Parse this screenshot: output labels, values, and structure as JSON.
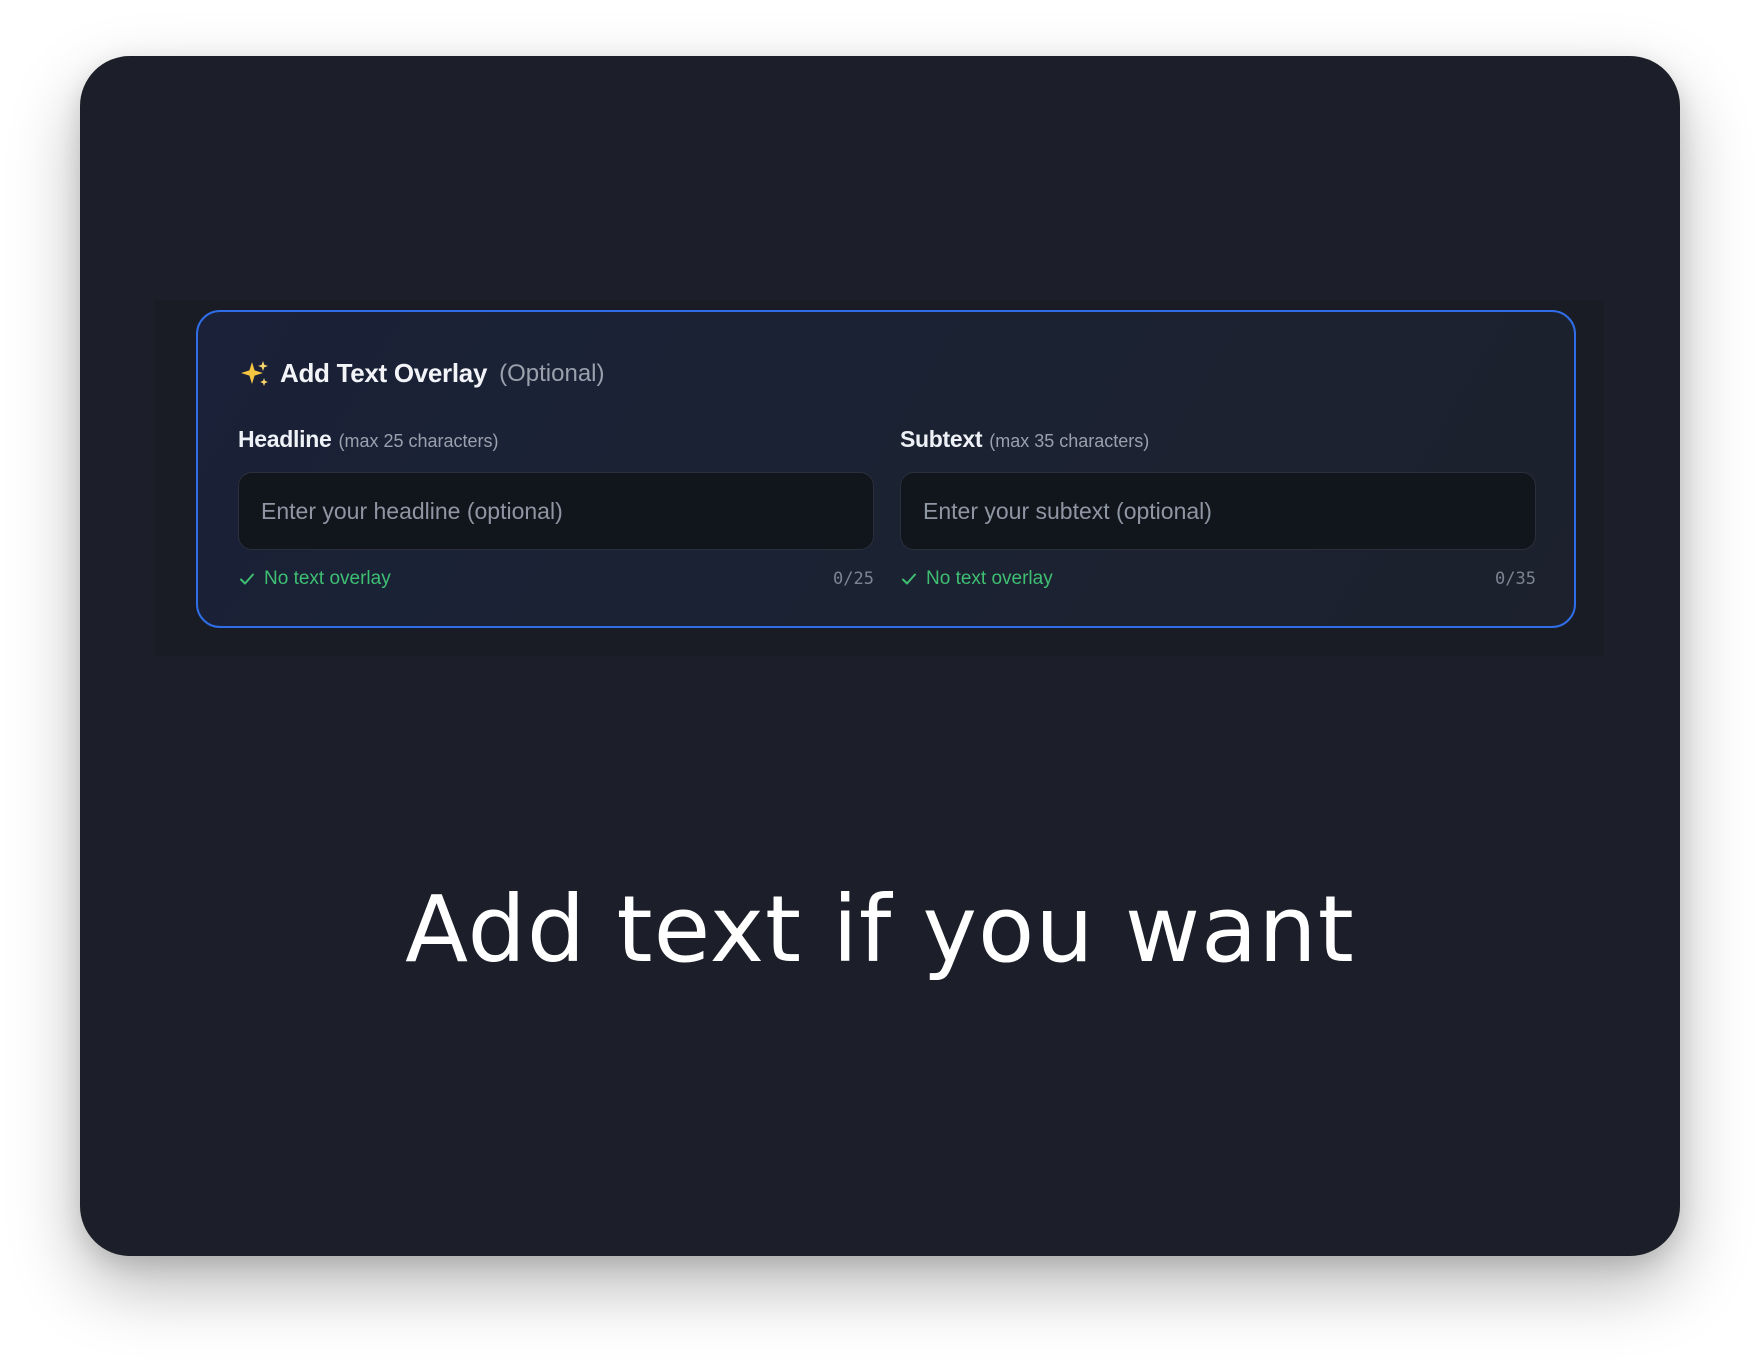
{
  "overlay": {
    "title": "Add Text Overlay",
    "optional": "(Optional)",
    "icon": "sparkles-icon",
    "accent_color": "#2f6ee8"
  },
  "fields": [
    {
      "label": "Headline",
      "hint": "(max 25 characters)",
      "value": "",
      "placeholder": "Enter your headline (optional)",
      "status": "No text overlay",
      "counter": "0/25"
    },
    {
      "label": "Subtext",
      "hint": "(max 35 characters)",
      "value": "",
      "placeholder": "Enter your subtext (optional)",
      "status": "No text overlay",
      "counter": "0/35"
    }
  ],
  "status_color": "#3fbf72",
  "caption": "Add text if you want"
}
